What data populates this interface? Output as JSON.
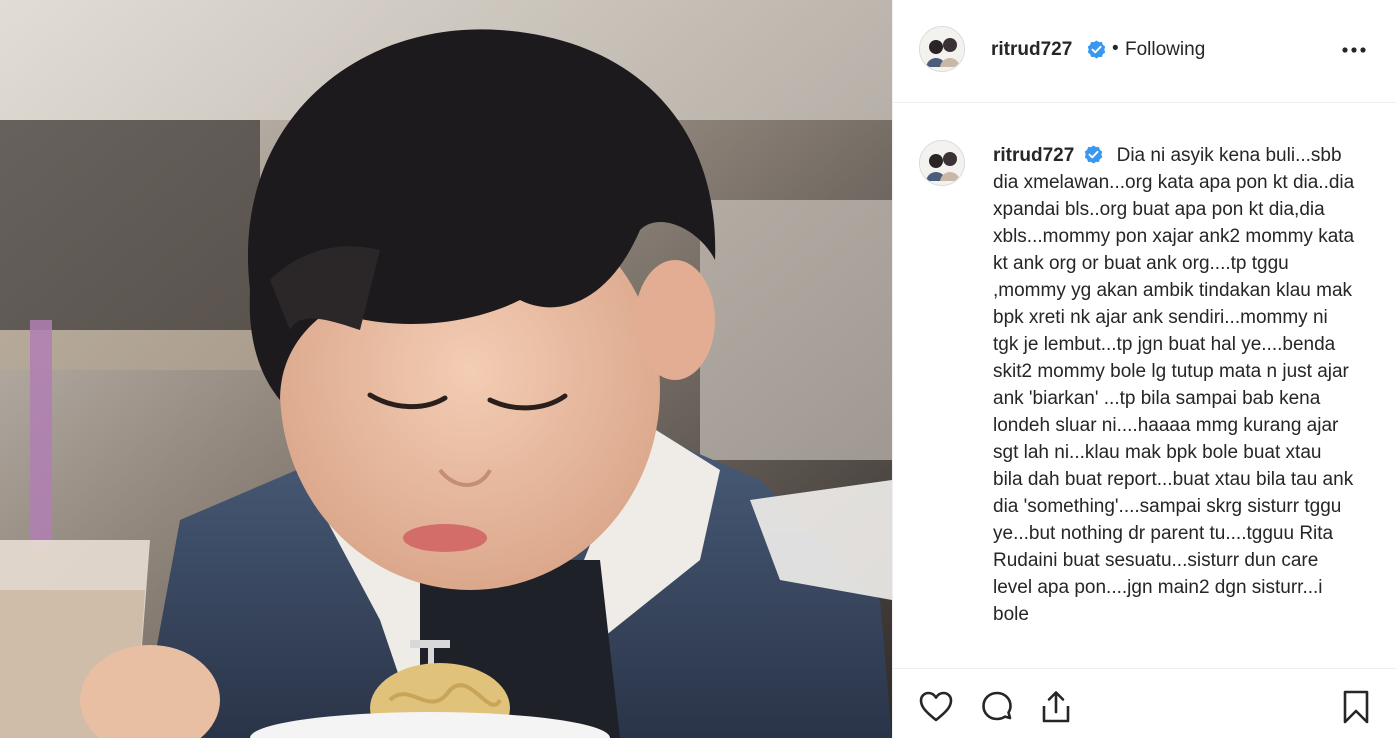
{
  "post": {
    "author": "ritrud727",
    "verified": true,
    "follow_state": "Following",
    "separator": "•",
    "caption": "Dia ni asyik kena buli...sbb dia xmelawan...org kata apa pon kt dia..dia xpandai bls..org buat apa pon kt dia,dia xbls...mommy pon xajar ank2 mommy kata kt ank org or buat ank org....tp tggu ,mommy yg akan ambik tindakan klau mak bpk xreti nk ajar ank sendiri...mommy ni tgk je lembut...tp jgn buat hal ye....benda skit2 mommy bole lg tutup mata n just ajar ank 'biarkan' ...tp bila sampai bab kena londeh sluar ni....haaaa mmg kurang ajar sgt lah ni...klau mak bpk bole buat xtau bila dah buat report...buat xtau bila tau ank dia 'something'....sampai skrg sisturr tggu ye...but nothing dr parent tu....tgguu Rita Rudaini buat sesuatu...sisturr dun care level apa pon....jgn main2 dgn sisturr...i bole"
  },
  "icons": {
    "more": "more-options-icon",
    "verified": "verified-badge-icon",
    "like": "heart-icon",
    "comment": "comment-bubble-icon",
    "share": "share-icon",
    "save": "bookmark-icon"
  },
  "colors": {
    "verified_blue": "#3897f0",
    "text": "#262626",
    "divider": "#efefef"
  }
}
